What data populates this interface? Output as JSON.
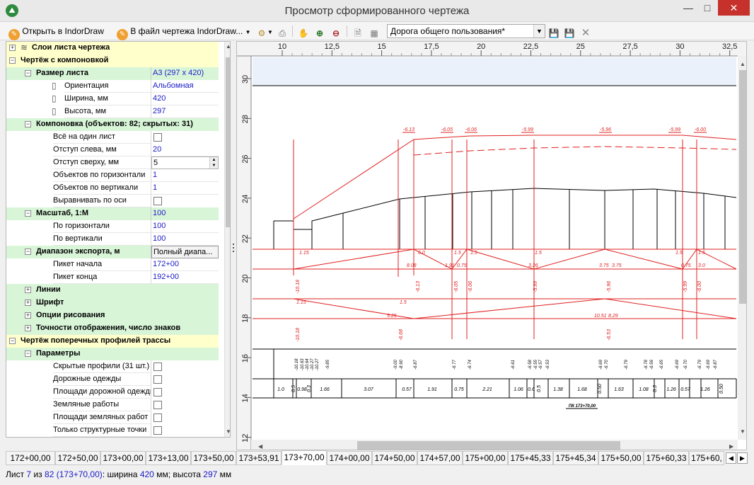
{
  "window": {
    "title": "Просмотр сформированного чертежа"
  },
  "toolbar": {
    "open_indordraw": "Открыть в IndorDraw",
    "to_drawing_file": "В файл чертежа IndorDraw...",
    "road_type": "Дорога общего пользования*"
  },
  "tree": [
    {
      "kind": "cat",
      "level": 0,
      "color": "yellow",
      "expander": "+",
      "label": "Слои листа чертежа",
      "icon": "layers-icon"
    },
    {
      "kind": "cat",
      "level": 0,
      "color": "yellow",
      "expander": "-",
      "label": "Чертёж с компоновкой"
    },
    {
      "kind": "cat",
      "level": 1,
      "color": "green",
      "expander": "-",
      "label": "Размер листа",
      "value": "А3 (297 x 420)"
    },
    {
      "kind": "prop",
      "level": 2,
      "label": "Ориентация",
      "value": "Альбомная",
      "icon": "page-orientation-icon"
    },
    {
      "kind": "prop",
      "level": 2,
      "label": "Ширина, мм",
      "value": "420",
      "icon": "page-width-icon"
    },
    {
      "kind": "prop",
      "level": 2,
      "label": "Высота, мм",
      "value": "297",
      "icon": "page-height-icon"
    },
    {
      "kind": "cat",
      "level": 1,
      "color": "green",
      "expander": "-",
      "label": "Компоновка (объектов: 82; скрытых: 31)"
    },
    {
      "kind": "check",
      "level": 2,
      "label": "Всё на один лист",
      "checked": false
    },
    {
      "kind": "prop",
      "level": 2,
      "label": "Отступ слева, мм",
      "value": "20"
    },
    {
      "kind": "spin",
      "level": 2,
      "label": "Отступ сверху, мм",
      "value": "5"
    },
    {
      "kind": "prop",
      "level": 2,
      "label": "Объектов по горизонтали",
      "value": "1"
    },
    {
      "kind": "prop",
      "level": 2,
      "label": "Объектов по вертикали",
      "value": "1"
    },
    {
      "kind": "check",
      "level": 2,
      "label": "Выравнивать по оси",
      "checked": false
    },
    {
      "kind": "cat",
      "level": 1,
      "color": "green",
      "expander": "-",
      "label": "Масштаб, 1:М",
      "value": "100"
    },
    {
      "kind": "prop",
      "level": 2,
      "label": "По горизонтали",
      "value": "100"
    },
    {
      "kind": "prop",
      "level": 2,
      "label": "По вертикали",
      "value": "100"
    },
    {
      "kind": "cat",
      "level": 1,
      "color": "green",
      "expander": "-",
      "label": "Диапазон экспорта, м",
      "dropdown": "Полный диапа..."
    },
    {
      "kind": "prop",
      "level": 2,
      "label": "Пикет начала",
      "value": "172+00"
    },
    {
      "kind": "prop",
      "level": 2,
      "label": "Пикет конца",
      "value": "192+00"
    },
    {
      "kind": "cat",
      "level": 1,
      "color": "green",
      "expander": "+",
      "label": "Линии"
    },
    {
      "kind": "cat",
      "level": 1,
      "color": "green",
      "expander": "+",
      "label": "Шрифт"
    },
    {
      "kind": "cat",
      "level": 1,
      "color": "green",
      "expander": "+",
      "label": "Опции рисования"
    },
    {
      "kind": "cat",
      "level": 1,
      "color": "green",
      "expander": "+",
      "label": "Точности отображения, число знаков"
    },
    {
      "kind": "cat",
      "level": 0,
      "color": "yellow",
      "expander": "-",
      "label": "Чертёж поперечных профилей трассы"
    },
    {
      "kind": "cat",
      "level": 1,
      "color": "green",
      "expander": "-",
      "label": "Параметры"
    },
    {
      "kind": "check",
      "level": 2,
      "label": "Скрытые профили (31 шт.)",
      "checked": false
    },
    {
      "kind": "check",
      "level": 2,
      "label": "Дорожные одежды",
      "checked": false
    },
    {
      "kind": "check",
      "level": 2,
      "label": "Площади дорожной одежды",
      "checked": false
    },
    {
      "kind": "check",
      "level": 2,
      "label": "Земляные работы",
      "checked": false
    },
    {
      "kind": "check",
      "level": 2,
      "label": "Площади земляных работ",
      "checked": false
    },
    {
      "kind": "check",
      "level": 2,
      "label": "Только структурные точки",
      "checked": false
    }
  ],
  "drawing": {
    "ruler_top": [
      "10",
      "12,5",
      "15",
      "17,5",
      "20",
      "22,5",
      "25",
      "27,5",
      "30",
      "32,5"
    ],
    "ruler_left": [
      "30",
      "28",
      "26",
      "24",
      "22",
      "20",
      "18",
      "16",
      "14",
      "12"
    ],
    "top_marks": [
      "-6.13",
      "-6.05",
      "-6.06",
      "-5.99",
      "-5.96",
      "-5.99",
      "-6.00"
    ],
    "band1_left": [
      "1.15",
      "6.0",
      "1.5",
      "1.5",
      "1.5",
      "1.5",
      "1.5"
    ],
    "band1_right": [
      "8.08",
      "1.91",
      "0.75",
      "3.26",
      "3.75",
      "3.75",
      "0.75",
      "3.0"
    ],
    "rot1": [
      "-10.18",
      "-6.13",
      "-6.05",
      "-6.06",
      "-5.99",
      "-5.96",
      "-5.99",
      "-6.00"
    ],
    "band2_labels": [
      "1.15",
      "1.5",
      "5.25",
      "10.51",
      "8.29"
    ],
    "rot2": [
      "-10.18",
      "-6.68",
      "-6.53"
    ],
    "rot3": [
      "-10.18",
      "-10.63",
      "-10.64",
      "-10.27",
      "-10.27",
      "-9.85",
      "-9.00",
      "-8.90",
      "-6.87",
      "-6.77",
      "-6.74",
      "-6.61",
      "-6.58",
      "-6.55",
      "-6.57",
      "-6.53",
      "-6.69",
      "-6.70",
      "-6.79",
      "-6.78",
      "-6.56",
      "-6.65",
      "-6.69",
      "-6.70",
      "-6.79",
      "-6.69",
      "-6.87"
    ],
    "dist_labels": [
      "1.0",
      "0.5",
      "0.98",
      "0.3",
      "1.66",
      "3.07",
      "0.57",
      "1.91",
      "0.75",
      "2.21",
      "1.06",
      "0.6",
      "0.5",
      "1.38",
      "1.68",
      "0.50",
      "1.63",
      "1.08",
      "0.3",
      "1.26",
      "0.57",
      "1.26",
      "0.50"
    ],
    "pk_caption": "ПК 173+70,00"
  },
  "tabs": [
    "172+00,00",
    "172+50,00",
    "173+00,00",
    "173+13,00",
    "173+50,00",
    "173+53,91",
    "173+70,00",
    "174+00,00",
    "174+50,00",
    "174+57,00",
    "175+00,00",
    "175+45,33",
    "175+45,34",
    "175+50,00",
    "175+60,33",
    "175+60,"
  ],
  "status": {
    "prefix": "Лист",
    "sheet": "7",
    "of_word": "из",
    "total": "82",
    "pk": "(173+70,00)",
    "width_label": ": ширина",
    "width": "420",
    "mm1": "мм; высота",
    "height": "297",
    "mm2": "мм"
  }
}
